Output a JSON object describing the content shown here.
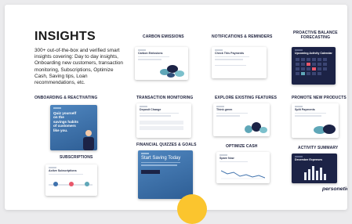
{
  "slide": {
    "title": "INSIGHTS",
    "intro": "300+ out-of-the-box and verified smart insights covering: Day to day insights, Onboarding new customers, transaction monitoring, Subscriptions, Optimize Cash, Saving tips, Loan recommendations, etc.",
    "logo": "personetics"
  },
  "sections": {
    "carbon": {
      "label": "CARBON EMISSIONS",
      "card_title": "Carbon Emissions"
    },
    "notifications": {
      "label": "NOTIFICATIONS & REMINDERS",
      "card_title": "Check This Payments"
    },
    "proactive": {
      "label_line1": "PROACTIVE BALANCE",
      "label_line2": "FORECASTING",
      "card_title": "Upcoming Activity Calendar"
    },
    "onboarding": {
      "label": "ONBOARDING & REACTIVATING",
      "card_title": "Quiz yourself on the savings habits of customers like you."
    },
    "transaction": {
      "label": "TRANSACTION MONITORING",
      "card_title": "Deposit Change"
    },
    "explore": {
      "label": "EXPLORE EXISTING FEATURES",
      "card_title": "Think green"
    },
    "promote": {
      "label": "PROMOTE NEW PRODUCTS",
      "card_title": "Split Payments"
    },
    "subscriptions": {
      "label": "SUBSCRIPTIONS",
      "card_title": "Active Subscriptions"
    },
    "quizzes": {
      "label": "FINANCIAL QUIZZES & GOALS",
      "card_title": "Start Saving Today"
    },
    "optimize": {
      "label": "OPTIMIZE CASH",
      "card_title": "Spare Now"
    },
    "activity": {
      "label": "ACTIVITY SUMMARY",
      "card_title": "December Expenses"
    }
  },
  "colors": {
    "navy": "#1c2346",
    "blue": "#3f72ad",
    "teal": "#5fa7b8",
    "accent": "#fbc52e"
  }
}
